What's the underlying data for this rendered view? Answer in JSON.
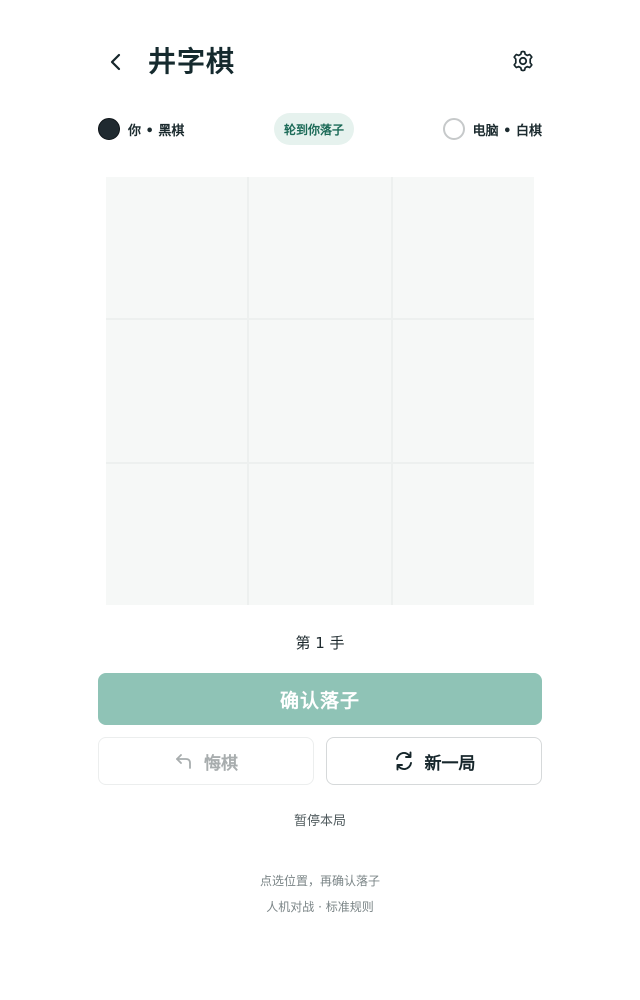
{
  "header": {
    "title": "井字棋",
    "back_icon": "chevron-left-icon",
    "settings_icon": "gear-icon"
  },
  "players": {
    "human": {
      "label": "你 • 黑棋",
      "stone": "black"
    },
    "turn_badge": "轮到你落子",
    "computer": {
      "label": "电脑 • 白棋",
      "stone": "white"
    }
  },
  "board": {
    "size": 3,
    "cells": [
      "",
      "",
      "",
      "",
      "",
      "",
      "",
      "",
      ""
    ]
  },
  "status": {
    "move_count": "第 1 手"
  },
  "actions": {
    "confirm_label": "确认落子",
    "undo_label": "悔棋",
    "undo_icon": "undo-arrow-icon",
    "new_game_label": "新一局",
    "new_game_icon": "refresh-icon",
    "pause_label": "暂停本局"
  },
  "footer": {
    "hint": "点选位置，再确认落子",
    "mode": "人机对战 · 标准规则"
  },
  "colors": {
    "accent": "#8fc3b6",
    "badge_bg": "#e6f2ee",
    "badge_text": "#1c6b58",
    "board_bg": "#f6f8f7"
  }
}
